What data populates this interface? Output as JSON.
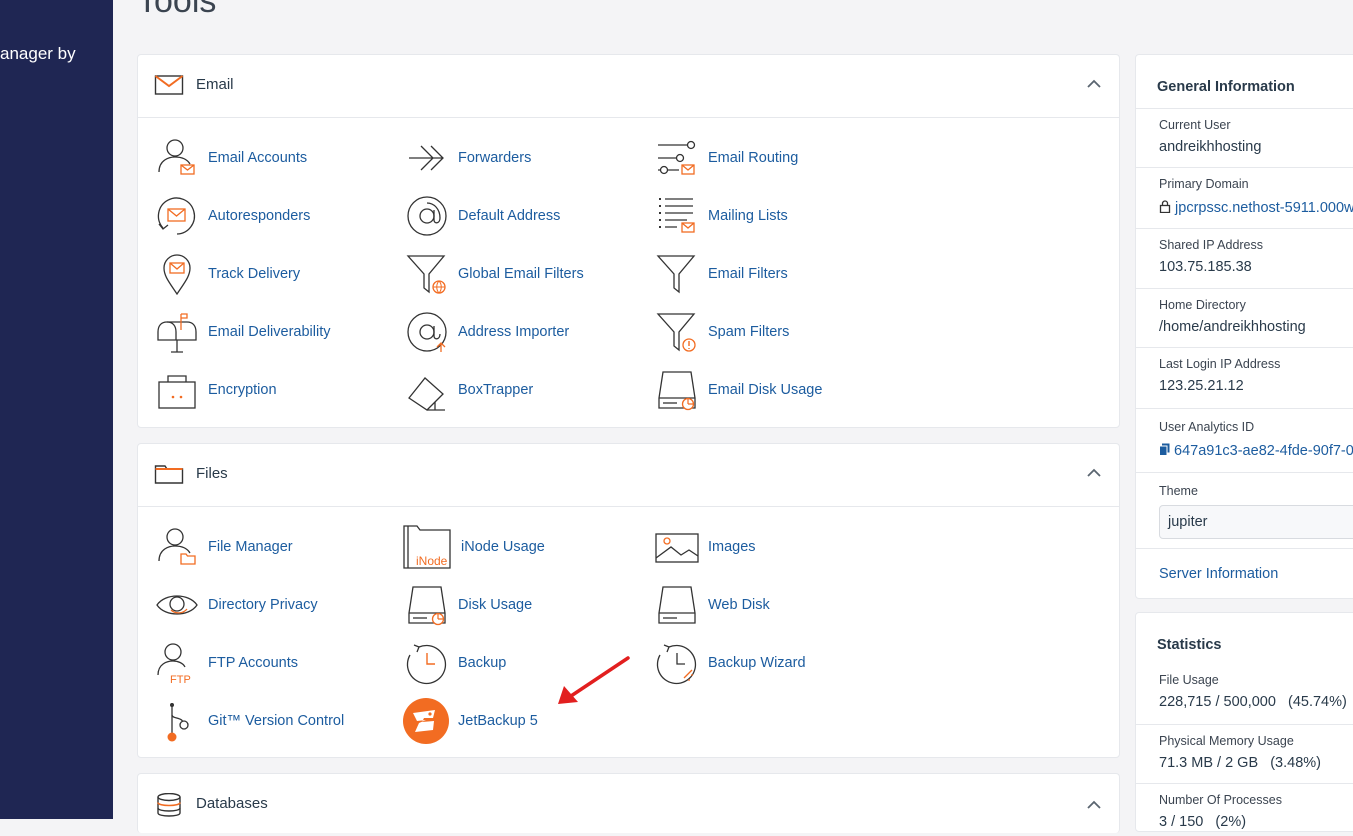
{
  "sidebar": {
    "brand_text": "anager by"
  },
  "page": {
    "title": "Tools"
  },
  "email_section": {
    "title": "Email",
    "tools": [
      {
        "label": "Email Accounts",
        "icon": "email-accounts-icon"
      },
      {
        "label": "Forwarders",
        "icon": "forwarders-icon"
      },
      {
        "label": "Email Routing",
        "icon": "email-routing-icon"
      },
      {
        "label": "Autoresponders",
        "icon": "autoresponders-icon"
      },
      {
        "label": "Default Address",
        "icon": "at-sign-icon"
      },
      {
        "label": "Mailing Lists",
        "icon": "mailing-lists-icon"
      },
      {
        "label": "Track Delivery",
        "icon": "track-delivery-icon"
      },
      {
        "label": "Global Email Filters",
        "icon": "global-filter-icon"
      },
      {
        "label": "Email Filters",
        "icon": "filter-icon"
      },
      {
        "label": "Email Deliverability",
        "icon": "mailbox-icon"
      },
      {
        "label": "Address Importer",
        "icon": "address-importer-icon"
      },
      {
        "label": "Spam Filters",
        "icon": "spam-filter-icon"
      },
      {
        "label": "Encryption",
        "icon": "encryption-icon"
      },
      {
        "label": "BoxTrapper",
        "icon": "boxtrapper-icon"
      },
      {
        "label": "Email Disk Usage",
        "icon": "disk-usage-icon"
      }
    ]
  },
  "files_section": {
    "title": "Files",
    "tools": [
      {
        "label": "File Manager",
        "icon": "file-manager-icon"
      },
      {
        "label": "iNode Usage",
        "icon": "inode-usage-icon"
      },
      {
        "label": "Images",
        "icon": "images-icon"
      },
      {
        "label": "Directory Privacy",
        "icon": "eye-icon"
      },
      {
        "label": "Disk Usage",
        "icon": "disk-usage-icon"
      },
      {
        "label": "Web Disk",
        "icon": "web-disk-icon"
      },
      {
        "label": "FTP Accounts",
        "icon": "ftp-accounts-icon"
      },
      {
        "label": "Backup",
        "icon": "backup-icon"
      },
      {
        "label": "Backup Wizard",
        "icon": "backup-wizard-icon"
      },
      {
        "label": "Git™ Version Control",
        "icon": "git-icon"
      },
      {
        "label": "JetBackup 5",
        "icon": "jetbackup-icon"
      }
    ],
    "inode_icon_text": "iNode",
    "ftp_icon_text": "FTP"
  },
  "databases_section": {
    "title": "Databases"
  },
  "general_info": {
    "title": "General Information",
    "current_user_label": "Current User",
    "current_user": "andreikhhosting",
    "primary_domain_label": "Primary Domain",
    "primary_domain": "jpcrpssc.nethost-5911.000w",
    "shared_ip_label": "Shared IP Address",
    "shared_ip": "103.75.185.38",
    "home_dir_label": "Home Directory",
    "home_dir": "/home/andreikhhosting",
    "last_login_label": "Last Login IP Address",
    "last_login": "123.25.21.12",
    "analytics_label": "User Analytics ID",
    "analytics_id": "647a91c3-ae82-4fde-90f7-0",
    "theme_label": "Theme",
    "theme_value": "jupiter",
    "server_info_link": "Server Information"
  },
  "statistics": {
    "title": "Statistics",
    "file_usage_label": "File Usage",
    "file_usage": "228,715 / 500,000   (45.74%)",
    "memory_label": "Physical Memory Usage",
    "memory": "71.3 MB / 2 GB   (3.48%)",
    "processes_label": "Number Of Processes",
    "processes": "3 / 150   (2%)"
  },
  "colors": {
    "accent": "#f26c22",
    "link": "#1c5c9f",
    "sidebar": "#1f2653",
    "annotation_arrow": "#e21f1f"
  }
}
